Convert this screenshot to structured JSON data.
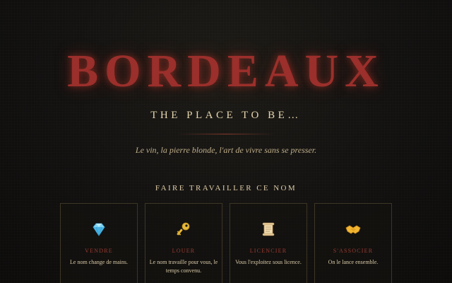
{
  "hero": {
    "brand": "BORDEAUX",
    "tagline": "THE PLACE TO BE…",
    "motto": "Le vin, la pierre blonde, l'art de vivre sans se presser."
  },
  "offers": {
    "section_title": "FAIRE TRAVAILLER CE NOM",
    "cards": [
      {
        "icon": "diamond-icon",
        "title": "VENDRE",
        "desc": "Le nom change de mains."
      },
      {
        "icon": "key-icon",
        "title": "LOUER",
        "desc": "Le nom travaille pour vous, le temps convenu."
      },
      {
        "icon": "scroll-icon",
        "title": "LICENCIER",
        "desc": "Vous l'exploitez sous licence."
      },
      {
        "icon": "handshake-icon",
        "title": "S'ASSOCIER",
        "desc": "On le lance ensemble."
      }
    ]
  },
  "colors": {
    "brand_red": "#9b2f2b",
    "gold_text": "#e6d6b0",
    "card_border": "#3d3626",
    "background": "#121110"
  }
}
